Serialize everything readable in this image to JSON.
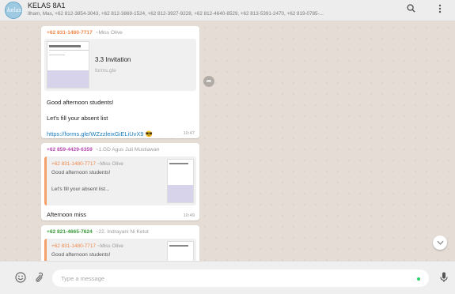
{
  "header": {
    "avatar_text": "kelas",
    "title": "KELAS 8A1",
    "members": "Ilham, Mas, +62 812-3854-3043, +62 812-3869-1524, +62 812-3927-9228, +62 812-4640-8529, +62 813-5391-2470, +62 819-0785-...",
    "search_icon": "search-icon",
    "menu_icon": "menu-dots-icon"
  },
  "messages": [
    {
      "sender_number": "+62 831-1480-7717",
      "sender_name": "~Miss Olive",
      "sender_color": "#f0884a",
      "preview_title": "3.3 Invitation",
      "preview_domain": "forms.gle",
      "text_1": "Good afternoon students!",
      "text_2": "Let's fill your absent list",
      "link": "https://forms.gle/WZzzleixGiELiUvX9",
      "emoji": "😎",
      "time": "10:47"
    },
    {
      "sender_number": "+62 859-4429-6359",
      "sender_name": "~1.GD Agus Juli Mustiawan",
      "sender_color": "#b64ab0",
      "quote_number": "+62 831-1480-7717",
      "quote_name": "~Miss Olive",
      "quote_line_1": "Good afternoon students!",
      "quote_line_2": "Let's fill your absent list...",
      "text": "Afternoon miss",
      "time": "10:49"
    },
    {
      "sender_number": "+62 821-4665-7624",
      "sender_name": "~22. Indrayani Ni Ketut",
      "sender_color": "#3a9a3a",
      "quote_number": "+62 831-1480-7717",
      "quote_name": "~Miss Olive",
      "quote_line_1": "Good afternoon students!"
    }
  ],
  "footer": {
    "placeholder": "Type a message",
    "emoji_icon": "emoji-icon",
    "attach_icon": "paperclip-icon",
    "mic_icon": "microphone-icon"
  },
  "colors": {
    "link": "#1e7ebf",
    "quote_border": "#f4a068",
    "online": "#25d366"
  }
}
